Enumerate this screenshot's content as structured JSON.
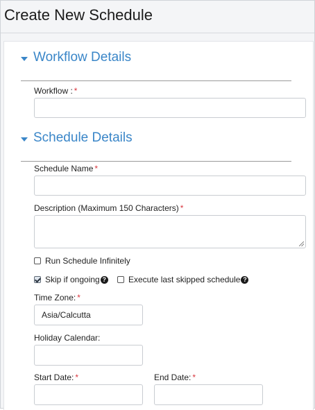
{
  "page": {
    "title": "Create New Schedule"
  },
  "workflow_section": {
    "title": "Workflow Details",
    "workflow_label": "Workflow :",
    "workflow_value": ""
  },
  "schedule_section": {
    "title": "Schedule Details",
    "schedule_name_label": "Schedule Name",
    "schedule_name_value": "",
    "description_label": "Description (Maximum 150 Characters)",
    "description_value": "",
    "run_infinitely_label": "Run Schedule Infinitely",
    "run_infinitely_checked": false,
    "skip_if_ongoing_label": "Skip if ongoing",
    "skip_if_ongoing_checked": true,
    "execute_last_skipped_label": "Execute last skipped schedule",
    "execute_last_skipped_checked": false,
    "time_zone_label": "Time Zone:",
    "time_zone_value": "Asia/Calcutta",
    "holiday_calendar_label": "Holiday Calendar:",
    "holiday_calendar_value": "",
    "start_date_label": "Start Date:",
    "start_date_value": "",
    "end_date_label": "End Date:",
    "end_date_value": ""
  },
  "required_marker": "*",
  "help_glyph": "?",
  "icons": [
    "caret-down-icon",
    "help-icon"
  ],
  "colors": {
    "section_title": "#3a86c8",
    "required": "#d9363e"
  }
}
